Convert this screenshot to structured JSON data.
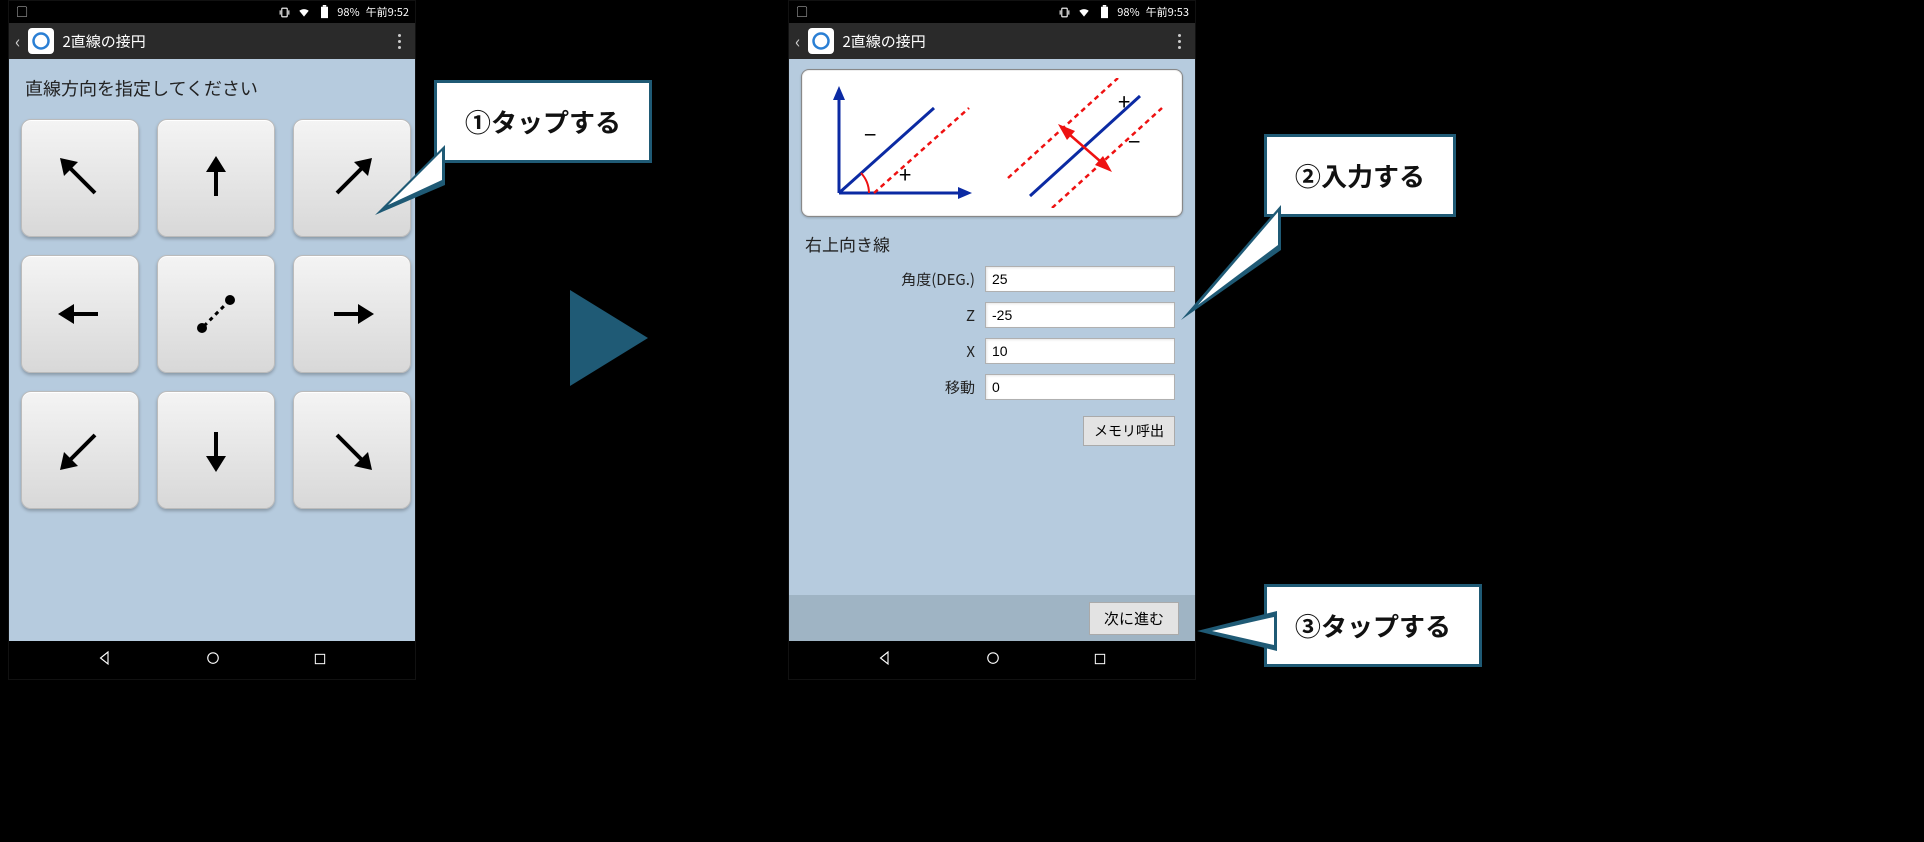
{
  "phone1": {
    "status": {
      "battery": "98%",
      "time": "午前9:52"
    },
    "app_title": "2直線の接円",
    "instruction": "直線方向を指定してください"
  },
  "phone2": {
    "status": {
      "battery": "98%",
      "time": "午前9:53"
    },
    "app_title": "2直線の接円",
    "subheader": "右上向き線",
    "fields": {
      "angle_label": "角度(DEG.)",
      "angle_value": "25",
      "z_label": "Z",
      "z_value": "-25",
      "x_label": "X",
      "x_value": "10",
      "move_label": "移動",
      "move_value": "0"
    },
    "memory_recall": "メモリ呼出",
    "next": "次に進む"
  },
  "callouts": {
    "c1": "①タップする",
    "c2": "②入力する",
    "c3": "③タップする"
  }
}
